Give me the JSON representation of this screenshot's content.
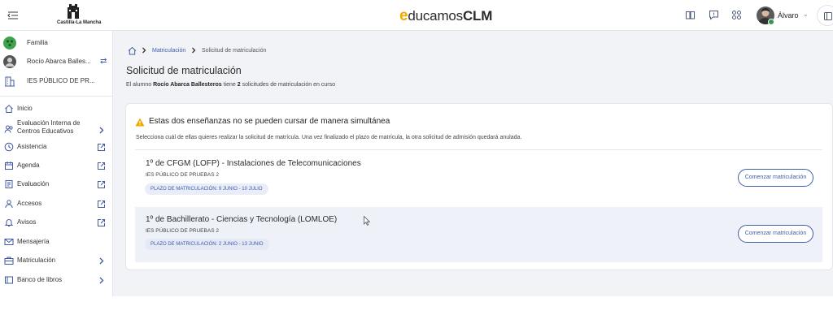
{
  "header": {
    "logo_text": "Castilla-La Mancha",
    "brand_e": "e",
    "brand_mid": "ducamos",
    "brand_clm": "CLM",
    "user_name": "Álvaro",
    "icons": [
      "book-icon",
      "chat-icon",
      "apps-grid-icon",
      "panel-icon"
    ]
  },
  "sidebar": {
    "context": [
      {
        "label": "Familia",
        "icon": "family-icon"
      },
      {
        "label": "Rocío Abarca Balles...",
        "icon": "avatar"
      },
      {
        "label": "IES PÚBLICO DE PR...",
        "icon": "building-icon"
      }
    ],
    "items": [
      {
        "label": "Inicio",
        "icon": "home-icon"
      },
      {
        "label": "Evaluación Interna de Centros Educativos",
        "icon": "people-icon",
        "trail": "chevron-right-icon"
      },
      {
        "label": "Asistencia",
        "icon": "clock-icon",
        "trail": "external-link-icon"
      },
      {
        "label": "Agenda",
        "icon": "calendar-icon",
        "trail": "external-link-icon"
      },
      {
        "label": "Evaluación",
        "icon": "document-icon",
        "trail": "external-link-icon"
      },
      {
        "label": "Accesos",
        "icon": "person-icon",
        "trail": "external-link-icon"
      },
      {
        "label": "Avisos",
        "icon": "bell-icon",
        "trail": "external-link-icon"
      },
      {
        "label": "Mensajería",
        "icon": "mail-icon"
      },
      {
        "label": "Matriculación",
        "icon": "briefcase-icon",
        "trail": "chevron-right-icon"
      },
      {
        "label": "Banco de libros",
        "icon": "book-stack-icon",
        "trail": "chevron-right-icon"
      }
    ]
  },
  "breadcrumb": {
    "items": [
      "Matriculación",
      "Solicitud de matriculación"
    ]
  },
  "page": {
    "title": "Solicitud de matriculación",
    "sub_pre": "El alumno ",
    "sub_student": "Rocío Abarca Ballesteros",
    "sub_mid": " tiene ",
    "sub_count": "2",
    "sub_post": " solicitudes de matriculación en curso"
  },
  "warning": {
    "title": "Estas dos enseñanzas no se pueden cursar de manera simultánea",
    "description": "Selecciona cuál de ellas quieres realizar la solicitud de matrícula. Una vez finalizado el plazo de matrícula, la otra solicitud de admisión quedará anulada."
  },
  "options": [
    {
      "title": "1º de CFGM (LOFP) - Instalaciones de Telecomunicaciones",
      "school": "IES PÚBLICO DE PRUEBAS 2",
      "period": "PLAZO DE MATRICULACIÓN: 9 JUNIO - 10 JULIO",
      "button": "Comenzar matriculación"
    },
    {
      "title": "1º de Bachillerato - Ciencias y Tecnología (LOMLOE)",
      "school": "IES PÚBLICO DE PRUEBAS 2",
      "period": "PLAZO DE MATRICULACIÓN: 2 JUNIO - 13 JUNIO",
      "button": "Comenzar matriculación"
    }
  ],
  "colors": {
    "accent": "#3f5ea8",
    "warning": "#f2a900",
    "brand_e": "#f2a900",
    "status_online": "#2e9a4b"
  }
}
